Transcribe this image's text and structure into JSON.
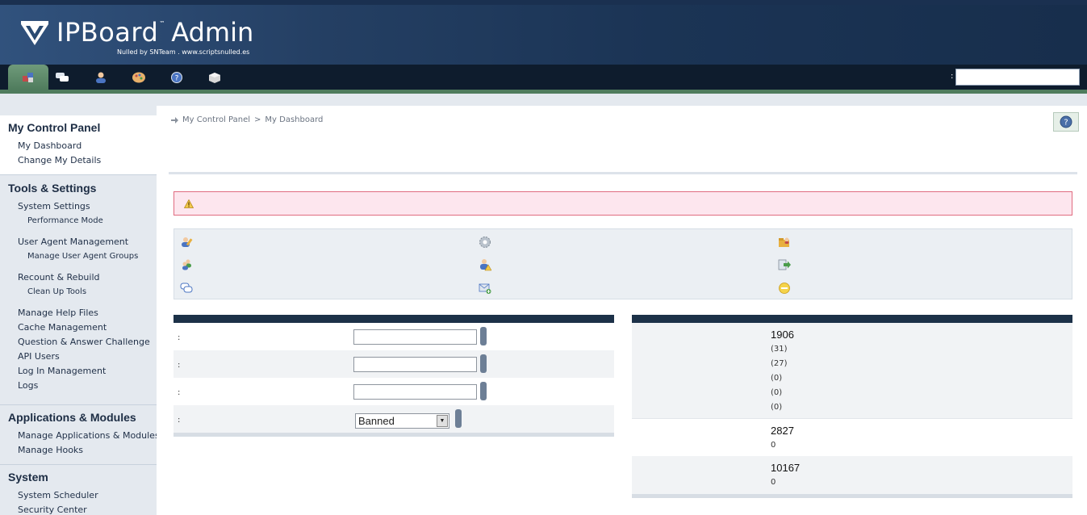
{
  "header": {
    "brand": "IPBoard",
    "tm": "™",
    "admin": "Admin",
    "nulled": "Nulled by SNTeam  .  www.scriptsnulled.es"
  },
  "tabs": [
    {
      "icon": "home-blocks-icon",
      "active": true
    },
    {
      "icon": "chat-bubbles-icon",
      "active": false
    },
    {
      "icon": "members-icon",
      "active": false
    },
    {
      "icon": "palette-icon",
      "active": false
    },
    {
      "icon": "help-circle-icon",
      "active": false
    },
    {
      "icon": "block-icon",
      "active": false
    }
  ],
  "search": {
    "label": ":",
    "value": ""
  },
  "sidebar": {
    "sections": [
      {
        "title": "My Control Panel",
        "items": [
          "My Dashboard",
          "Change My Details"
        ]
      },
      {
        "title": "Tools & Settings",
        "items": [
          "System Settings",
          "Performance Mode",
          "User Agent Management",
          "Manage User Agent Groups",
          "Recount & Rebuild",
          "Clean Up Tools",
          "Manage Help Files",
          "Cache Management",
          "Question & Answer Challenge",
          "API Users",
          "Log In Management",
          "Logs"
        ]
      },
      {
        "title": "Applications & Modules",
        "items": [
          "Manage Applications & Modules",
          "Manage Hooks"
        ]
      },
      {
        "title": "System",
        "items": [
          "System Scheduler",
          "Security Center"
        ]
      }
    ]
  },
  "breadcrumb": {
    "items": [
      "My Control Panel",
      "My Dashboard"
    ],
    "sep": ">"
  },
  "member_search": {
    "rows": [
      ":",
      ":",
      ":",
      ":"
    ],
    "select_value": "Banned"
  },
  "stats": {
    "members_total": "1906",
    "members_subs": [
      "(31)",
      "(27)",
      "(0)",
      "(0)",
      "(0)"
    ],
    "topics_total": "2827",
    "topics_sub": "0",
    "posts_total": "10167",
    "posts_sub": "0"
  },
  "colors": {
    "header_dark": "#172e4c",
    "tab_active": "#4f7c5d",
    "warning_bg": "#fde6ee",
    "warning_border": "#e06c80",
    "panel_head": "#1c3148"
  }
}
